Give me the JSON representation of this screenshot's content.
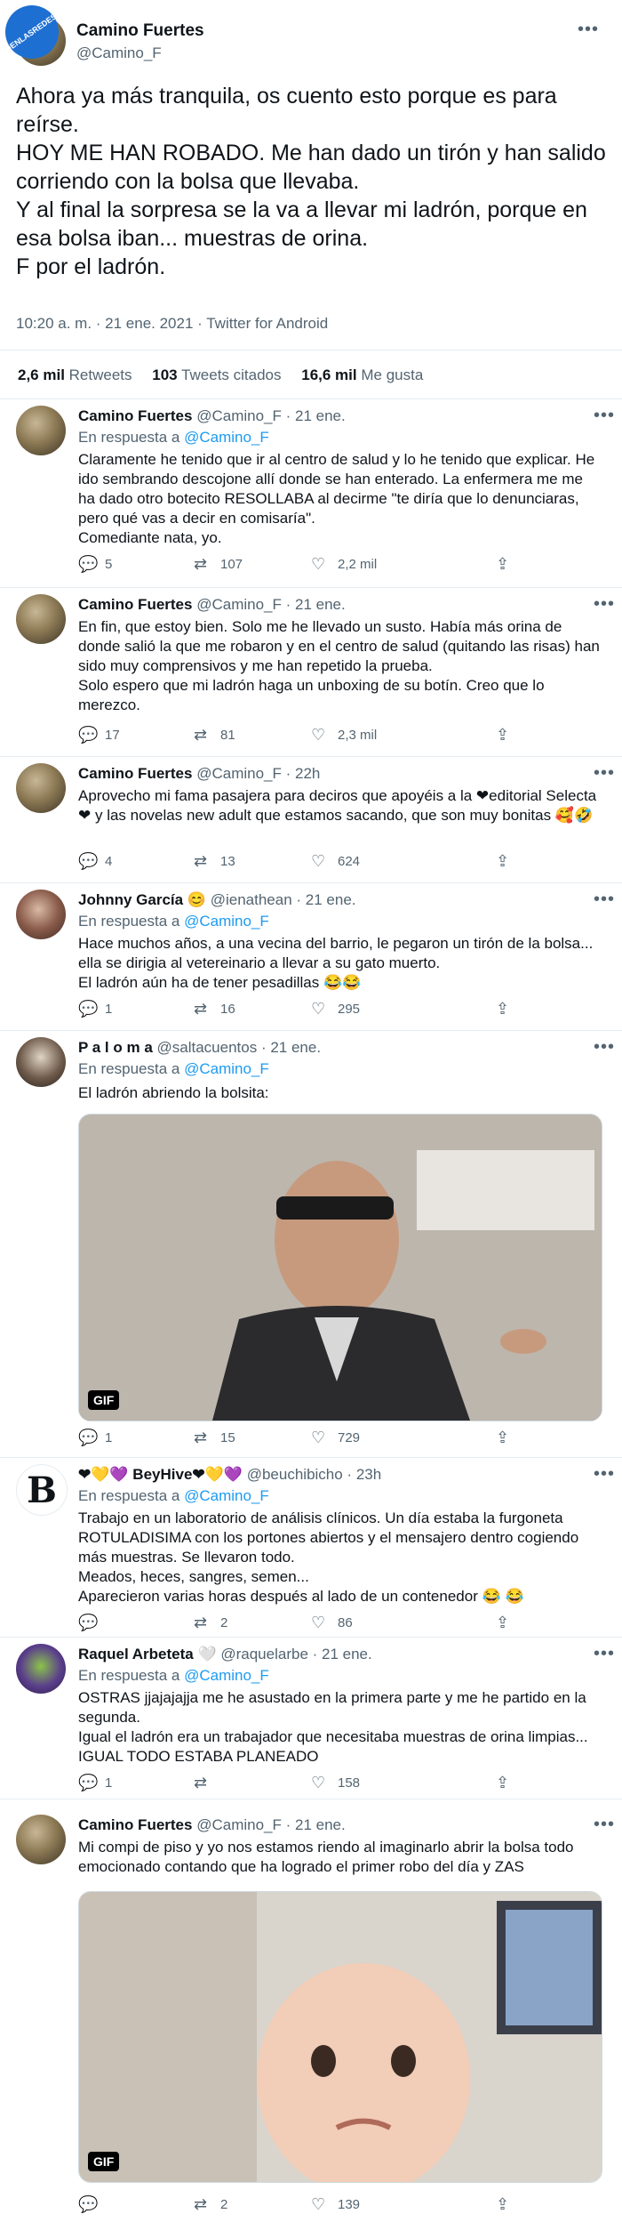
{
  "watermark": "VISTOENLASREDES.COM",
  "main": {
    "name": "Camino Fuertes",
    "handle": "@Camino_F",
    "text": "Ahora ya más tranquila, os cuento esto porque es para reírse.\nHOY ME HAN ROBADO. Me han dado un tirón y han salido corriendo con la bolsa que llevaba.\nY al final la sorpresa se la va a llevar mi ladrón, porque en esa bolsa iban... muestras de orina.\nF por el ladrón.",
    "meta": "10:20 a. m. · 21 ene. 2021 · Twitter for Android",
    "retweets_count": "2,6 mil",
    "retweets_label": "Retweets",
    "quotes_count": "103",
    "quotes_label": "Tweets citados",
    "likes_count": "16,6 mil",
    "likes_label": "Me gusta"
  },
  "reply_prefix": "En respuesta a",
  "tweets": [
    {
      "name": "Camino Fuertes",
      "handle": "@Camino_F · 21 ene.",
      "reply_to": "@Camino_F",
      "text": "Claramente he tenido que ir al centro de salud y lo he tenido que explicar. He ido sembrando descojone allí donde se han enterado. La enfermera me me ha dado otro botecito RESOLLABA al decirme \"te diría que lo denunciaras, pero qué vas a decir en comisaría\".\nComediante nata, yo.",
      "replies": "5",
      "retweets": "107",
      "likes": "2,2 mil"
    },
    {
      "name": "Camino Fuertes",
      "handle": "@Camino_F · 21 ene.",
      "reply_to": "@Camino_F",
      "text": "En fin, que estoy bien. Solo me he llevado un susto. Había más orina de donde salió la que me robaron y en el centro de salud (quitando las risas) han sido muy comprensivos y me han repetido la prueba.\nSolo espero que mi ladrón haga un unboxing de su botín. Creo que lo merezco.",
      "replies": "17",
      "retweets": "81",
      "likes": "2,3 mil"
    },
    {
      "name": "Camino Fuertes",
      "handle": "@Camino_F · 22h",
      "reply_to": "",
      "text": "Aprovecho mi fama pasajera para deciros que apoyéis a la ❤editorial Selecta❤ y las novelas new adult que estamos sacando, que son muy bonitas 🥰🤣",
      "replies": "4",
      "retweets": "13",
      "likes": "624"
    },
    {
      "name": "Johnny García 😊",
      "handle": "@ienathean · 21 ene.",
      "reply_to": "@Camino_F",
      "text": "Hace muchos años, a una vecina del barrio, le pegaron un tirón de la bolsa... ella se dirigia al vetereinario a llevar a su gato muerto.\nEl ladrón aún ha de tener pesadillas 😂😂",
      "replies": "1",
      "retweets": "16",
      "likes": "295"
    },
    {
      "name": "P a l o m a",
      "handle": "@saltacuentos · 21 ene.",
      "reply_to": "@Camino_F",
      "text": "El ladrón abriendo la bolsita:",
      "gif": "GIF",
      "replies": "1",
      "retweets": "15",
      "likes": "729"
    },
    {
      "name": "❤💛💜 BeyHive❤💛💜",
      "handle": "@beuchibicho · 23h",
      "reply_to": "@Camino_F",
      "text": "Trabajo en un laboratorio de análisis clínicos. Un día estaba la furgoneta ROTULADISIMA con los portones abiertos y el mensajero dentro cogiendo más muestras. Se llevaron todo.\nMeados, heces, sangres, semen...\nAparecieron varias horas después al lado de un contenedor 😂 😂",
      "replies": "",
      "retweets": "2",
      "likes": "86"
    },
    {
      "name": "Raquel Arbeteta 🤍",
      "handle": "@raquelarbe · 21 ene.",
      "reply_to": "@Camino_F",
      "text": "OSTRAS jjajajajja me he asustado en la primera parte y me he partido en la segunda.\nIgual el ladrón era un trabajador que necesitaba muestras de orina limpias... IGUAL TODO ESTABA PLANEADO",
      "replies": "1",
      "retweets": "",
      "likes": "158"
    },
    {
      "name": "Camino Fuertes",
      "handle": "@Camino_F · 21 ene.",
      "reply_to": "",
      "text": "Mi compi de piso y yo nos estamos riendo al imaginarlo abrir la bolsa todo emocionado contando que ha logrado el primer robo del día y ZAS",
      "gif": "GIF",
      "replies": "",
      "retweets": "2",
      "likes": "139"
    }
  ],
  "icons": {
    "reply": "reply-icon",
    "retweet": "retweet-icon",
    "like": "heart-icon",
    "share": "share-icon",
    "more": "more-icon"
  }
}
